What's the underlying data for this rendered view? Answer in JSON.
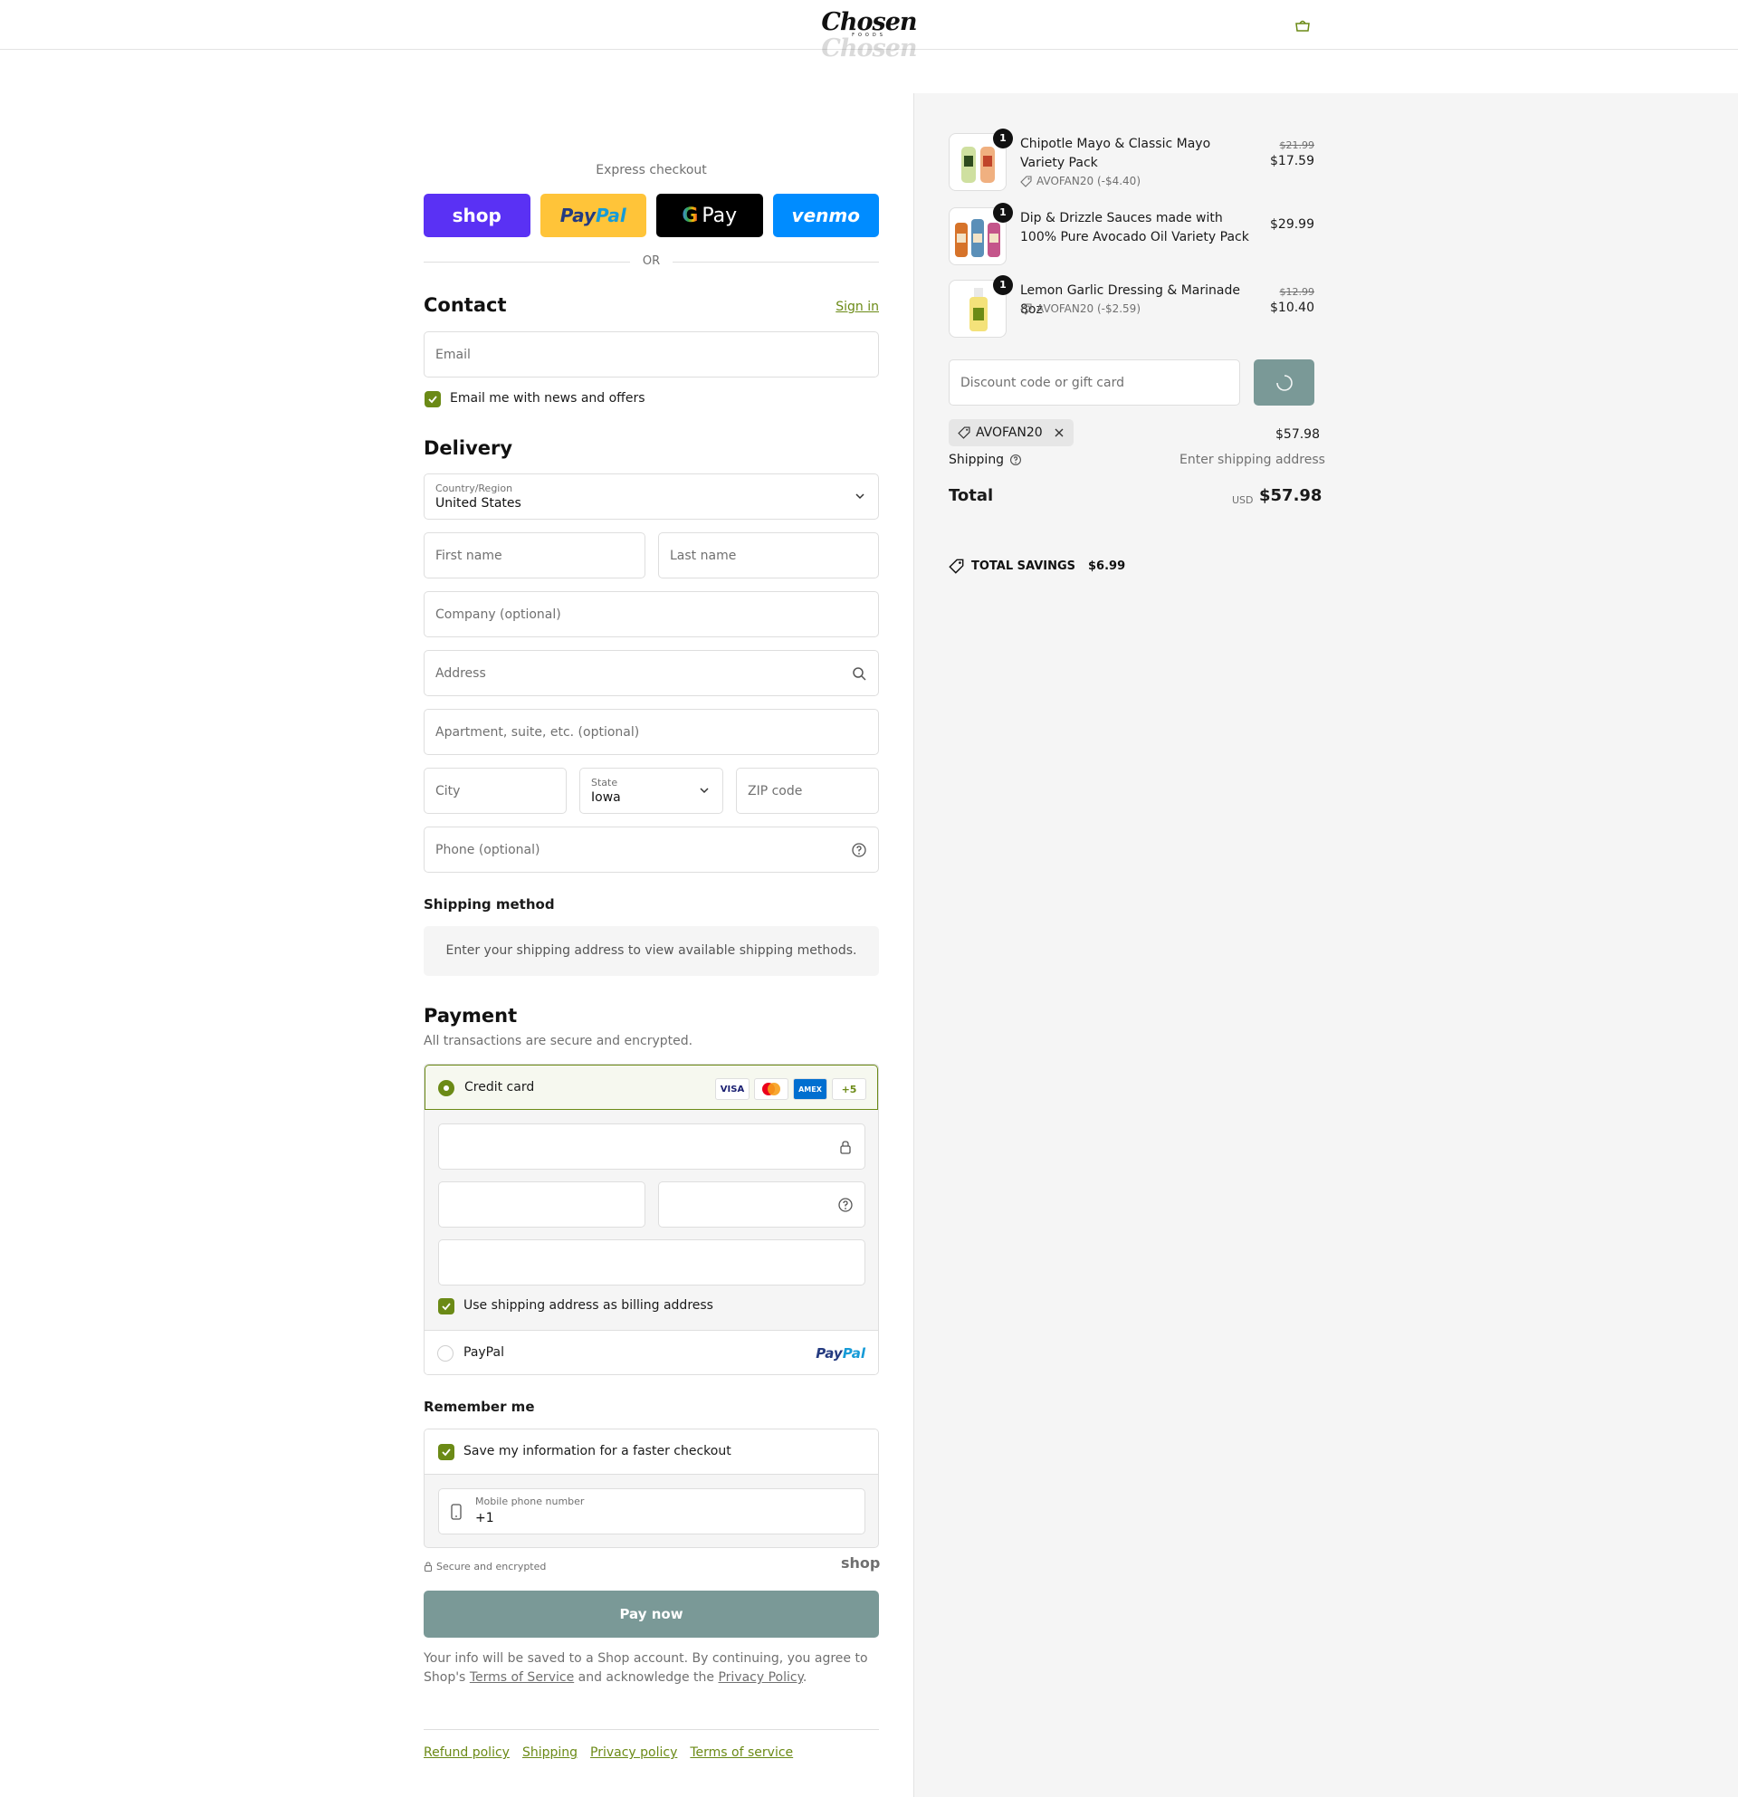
{
  "header": {
    "logo_text": "Chosen",
    "logo_sub": "FOODS",
    "cart_icon": "shopping-bag-icon"
  },
  "express": {
    "label": "Express checkout",
    "buttons": [
      {
        "name": "shop",
        "label": "shop",
        "color": "#5a31f4"
      },
      {
        "name": "paypal",
        "label_a": "Pay",
        "label_b": "Pal",
        "color": "#ffc439"
      },
      {
        "name": "gpay",
        "label_a": "G",
        "label_b": "Pay",
        "color": "#000000"
      },
      {
        "name": "venmo",
        "label": "venmo",
        "color": "#008cff"
      }
    ],
    "or_label": "OR"
  },
  "contact": {
    "title": "Contact",
    "sign_in": "Sign in",
    "email_placeholder": "Email",
    "news_label": "Email me with news and offers",
    "news_checked": true
  },
  "delivery": {
    "title": "Delivery",
    "country_label": "Country/Region",
    "country_value": "United States",
    "first_name_placeholder": "First name",
    "last_name_placeholder": "Last name",
    "company_placeholder": "Company (optional)",
    "address_placeholder": "Address",
    "apartment_placeholder": "Apartment, suite, etc. (optional)",
    "city_placeholder": "City",
    "state_label": "State",
    "state_value": "Iowa",
    "zip_placeholder": "ZIP code",
    "phone_placeholder": "Phone (optional)"
  },
  "shipping_method": {
    "title": "Shipping method",
    "message": "Enter your shipping address to view available shipping methods."
  },
  "payment": {
    "title": "Payment",
    "subtitle": "All transactions are secure and encrypted.",
    "credit_card_label": "Credit card",
    "card_brands": [
      "VISA",
      "MC",
      "AMEX"
    ],
    "more_brands": "+5",
    "billing_label": "Use shipping address as billing address",
    "billing_checked": true,
    "paypal_label": "PayPal",
    "paypal_logo_a": "Pay",
    "paypal_logo_b": "Pal"
  },
  "remember": {
    "title": "Remember me",
    "save_label": "Save my information for a faster checkout",
    "save_checked": true,
    "phone_label": "Mobile phone number",
    "phone_value": "+1"
  },
  "secure_label": "Secure and encrypted",
  "shop_mark": "shop",
  "pay_button": "Pay now",
  "legal": {
    "text_1": "Your info will be saved to a Shop account. By continuing, you agree to Shop's ",
    "terms_link": "Terms of Service",
    "text_2": " and acknowledge the ",
    "privacy_link": "Privacy Policy",
    "text_3": "."
  },
  "footer_links": [
    "Refund policy",
    "Shipping",
    "Privacy policy",
    "Terms of service"
  ],
  "summary": {
    "items": [
      {
        "name": "Chipotle Mayo & Classic Mayo Variety Pack",
        "qty": "1",
        "discount": "AVOFAN20 (-$4.40)",
        "old_price": "$21.99",
        "price": "$17.59"
      },
      {
        "name": "Dip & Drizzle Sauces made with 100% Pure Avocado Oil Variety Pack",
        "qty": "1",
        "discount": "",
        "old_price": "",
        "price": "$29.99"
      },
      {
        "name": "Lemon Garlic Dressing & Marinade 8oz",
        "qty": "1",
        "discount": "AVOFAN20 (-$2.59)",
        "old_price": "$12.99",
        "price": "$10.40"
      }
    ],
    "discount_placeholder": "Discount code or gift card",
    "applied_code": "AVOFAN20",
    "subtotal": "$57.98",
    "shipping_label": "Shipping",
    "shipping_value": "Enter shipping address",
    "total_label": "Total",
    "currency": "USD",
    "total": "$57.98",
    "savings_label": "TOTAL SAVINGS",
    "savings_amount": "$6.99"
  },
  "colors": {
    "accent": "#6b8a16",
    "button": "#7a9997",
    "panel": "#f5f5f5"
  }
}
